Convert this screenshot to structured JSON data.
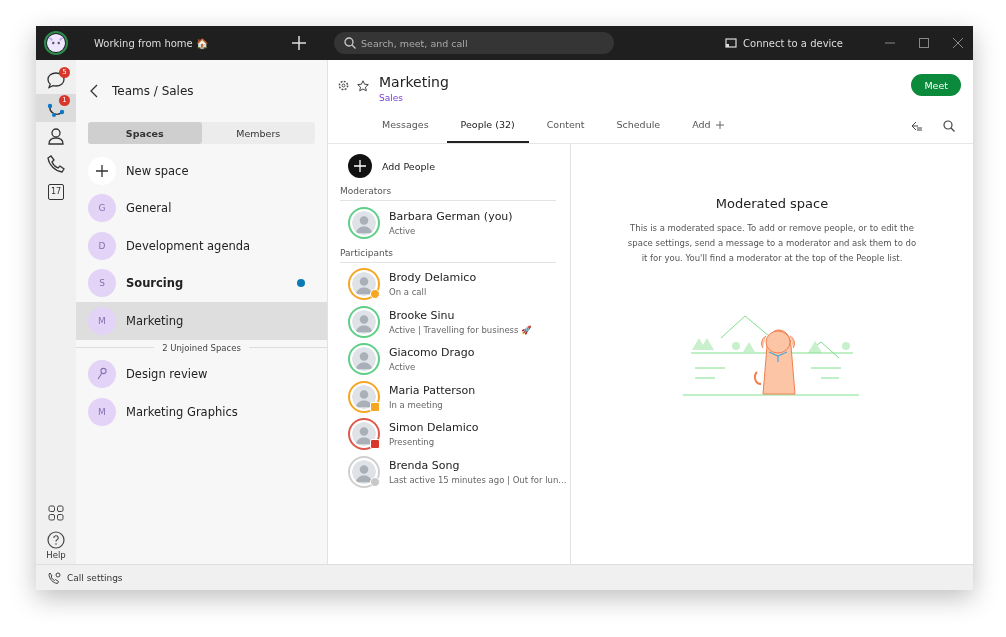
{
  "title_bar": {
    "status": "Working from home 🏠",
    "search": {
      "placeholder": "Search, meet, and call"
    },
    "connect": "Connect to a device"
  },
  "rail": {
    "items": [
      {
        "kind": "chat",
        "badge": "5",
        "selected": false
      },
      {
        "kind": "teams",
        "badge": "1",
        "selected": true
      },
      {
        "kind": "contacts",
        "selected": false
      },
      {
        "kind": "calls",
        "selected": false
      },
      {
        "kind": "calendar",
        "day": "17",
        "selected": false
      }
    ],
    "help": "Help"
  },
  "sidebar": {
    "breadcrumb": "Teams / Sales",
    "tabs": [
      {
        "label": "Spaces",
        "selected": true
      },
      {
        "label": "Members",
        "selected": false
      }
    ],
    "new_space": "New space",
    "spaces": [
      {
        "kind": "letter",
        "initial": "G",
        "name": "General",
        "unread": false,
        "selected": false
      },
      {
        "kind": "letter",
        "initial": "D",
        "name": "Development agenda",
        "unread": false,
        "selected": false
      },
      {
        "kind": "letter",
        "initial": "S",
        "name": "Sourcing",
        "unread": true,
        "selected": false
      },
      {
        "kind": "letter",
        "initial": "M",
        "name": "Marketing",
        "unread": false,
        "selected": true
      }
    ],
    "unjoined_label": "2 Unjoined Spaces",
    "unjoined": [
      {
        "kind": "key",
        "name": "Design review"
      },
      {
        "kind": "letter",
        "initial": "M",
        "name": "Marketing Graphics"
      }
    ]
  },
  "header": {
    "title": "Marketing",
    "subtitle": "Sales",
    "meet": "Meet",
    "tabs": [
      {
        "label": "Messages",
        "selected": false
      },
      {
        "label": "People (32)",
        "selected": true
      },
      {
        "label": "Content",
        "selected": false
      },
      {
        "label": "Schedule",
        "selected": false
      },
      {
        "label": "Add",
        "selected": false
      }
    ]
  },
  "people": {
    "add": "Add People",
    "groups": [
      {
        "label": "Moderators",
        "members": [
          {
            "name": "Barbara German (you)",
            "status": "Active",
            "kind": "active"
          }
        ]
      },
      {
        "label": "Participants",
        "members": [
          {
            "name": "Brody Delamico",
            "status": "On a call",
            "kind": "call"
          },
          {
            "name": "Brooke Sinu",
            "status": "Active  |  Travelling for business 🚀",
            "kind": "active"
          },
          {
            "name": "Giacomo Drago",
            "status": "Active",
            "kind": "active"
          },
          {
            "name": "Maria Patterson",
            "status": "In a meeting",
            "kind": "meeting"
          },
          {
            "name": "Simon Delamico",
            "status": "Presenting",
            "kind": "presenting"
          },
          {
            "name": "Brenda Song",
            "status": "Last active 15 minutes ago  |  Out for lun...",
            "kind": "away"
          }
        ]
      }
    ]
  },
  "info": {
    "title": "Moderated space",
    "body": "This is a moderated space. To add or remove people, or to edit the space settings, send a message to a moderator and ask them to do it for you. You'll find a moderator at the top of the People list."
  },
  "status_bar": {
    "call_settings": "Call settings"
  }
}
